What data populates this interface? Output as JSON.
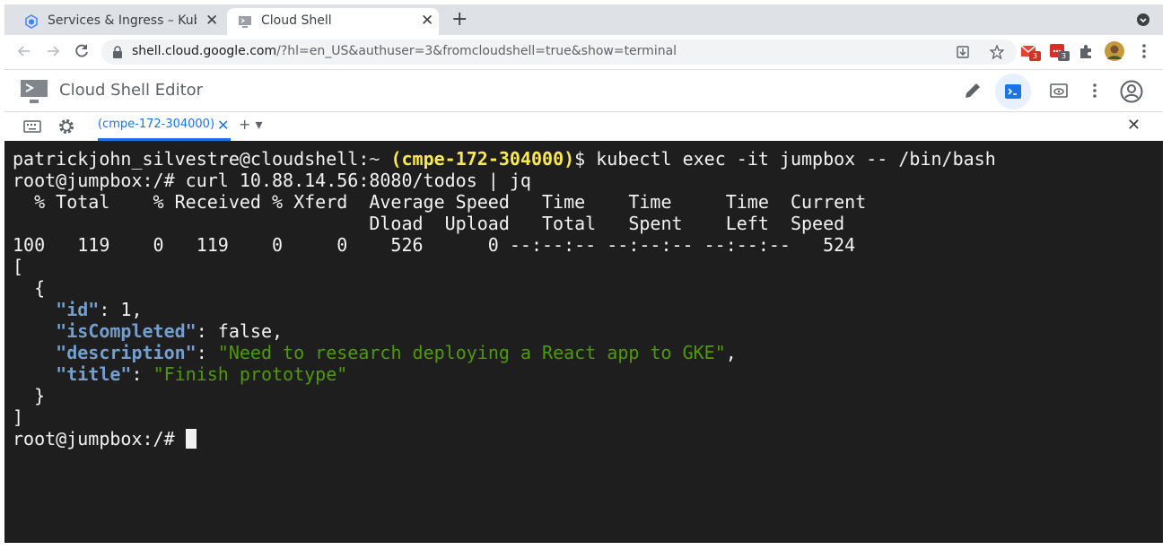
{
  "browser": {
    "tabs": [
      {
        "title": "Services & Ingress – Kubern",
        "close": "✕"
      },
      {
        "title": "Cloud Shell",
        "close": "✕"
      }
    ],
    "new_tab": "+",
    "url_host": "shell.cloud.google.com",
    "url_rest": "/?hl=en_US&authuser=3&fromcloudshell=true&show=terminal",
    "extension_badges": [
      "3",
      "3"
    ]
  },
  "editor": {
    "title": "Cloud Shell Editor"
  },
  "terminal_tabs": {
    "active_label": "(cmpe-172-304000)",
    "close": "✕",
    "add": "+ ▾",
    "panel_close": "✕"
  },
  "terminal": {
    "line1_user": "patrickjohn_silvestre@cloudshell:",
    "line1_path": "~",
    "line1_project": "(cmpe-172-304000)",
    "line1_cmd": "$ kubectl exec -it jumpbox -- /bin/bash",
    "line2": "root@jumpbox:/# curl 10.88.14.56:8080/todos | jq",
    "line3": "  % Total    % Received % Xferd  Average Speed   Time    Time     Time  Current",
    "line4": "                                 Dload  Upload   Total   Spent    Left  Speed",
    "line5": "100   119    0   119    0     0    526      0 --:--:-- --:--:-- --:--:--   524",
    "line6": "[",
    "line7": "  {",
    "id_key": "\"id\"",
    "id_val": ": 1,",
    "completed_key": "\"isCompleted\"",
    "completed_val": ": false,",
    "desc_key": "\"description\"",
    "desc_sep": ": ",
    "desc_val": "\"Need to research deploying a React app to GKE\"",
    "desc_end": ",",
    "title_key": "\"title\"",
    "title_sep": ": ",
    "title_val": "\"Finish prototype\"",
    "line12": "  }",
    "line13": "]",
    "prompt": "root@jumpbox:/# "
  },
  "colors": {
    "terminal_bg": "#1e1e1e",
    "project": "#fce94f",
    "json_key": "#729fcf",
    "json_string": "#4e9a06",
    "accent": "#1a73e8"
  }
}
